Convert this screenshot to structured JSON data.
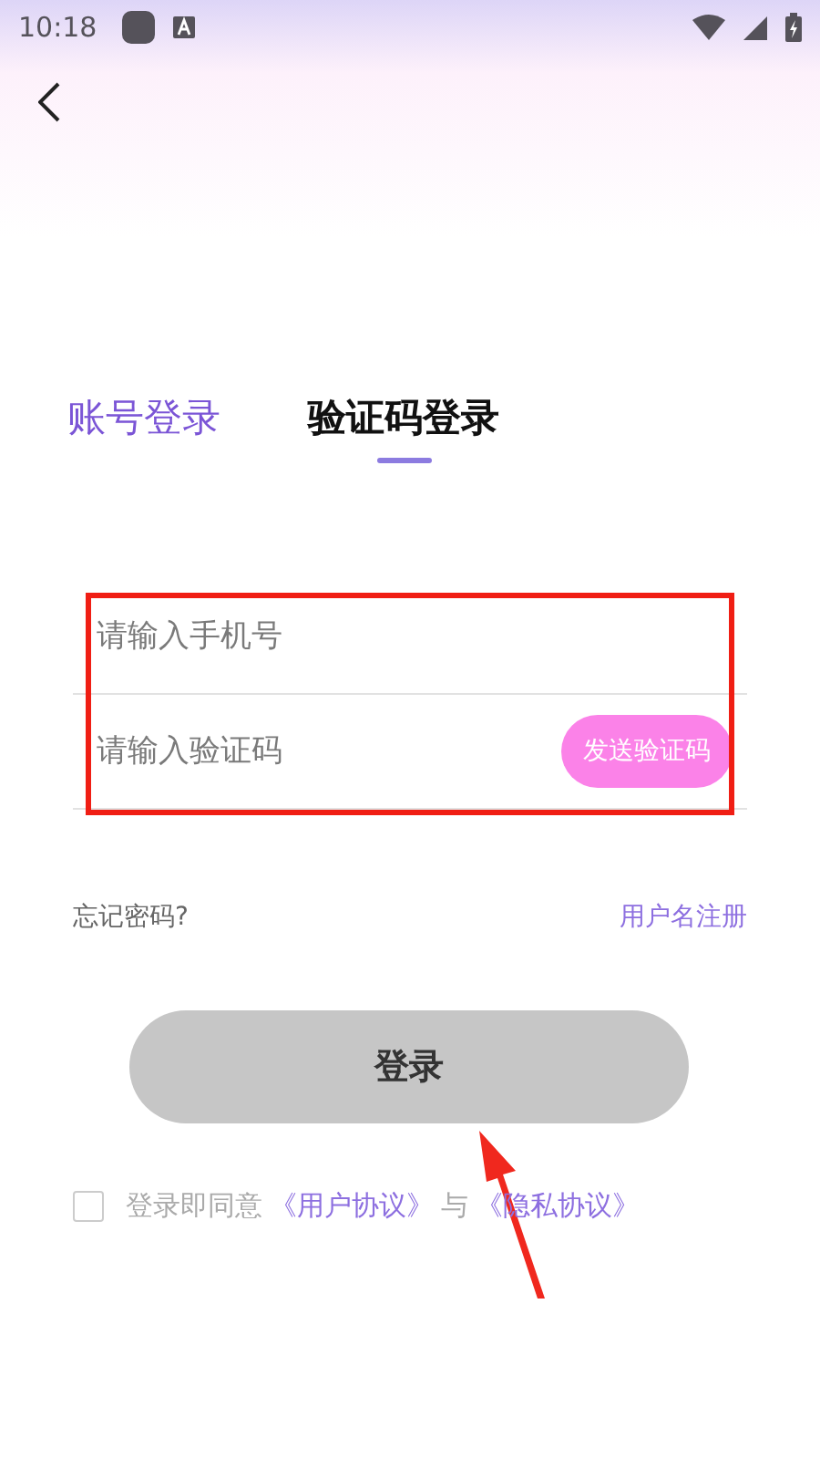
{
  "status_bar": {
    "time": "10:18"
  },
  "tabs": [
    {
      "label": "账号登录",
      "selected": false
    },
    {
      "label": "验证码登录",
      "selected": true
    }
  ],
  "phone_field": {
    "placeholder": "请输入手机号"
  },
  "code_field": {
    "placeholder": "请输入验证码"
  },
  "send_code_button": "发送验证码",
  "forgot_password": "忘记密码?",
  "register_link": "用户名注册",
  "login_button": "登录",
  "agreement": {
    "checked": false,
    "text": "登录即同意",
    "user_agreement": "《用户协议》",
    "conjunction": "与",
    "privacy_policy": "《隐私协议》"
  }
}
